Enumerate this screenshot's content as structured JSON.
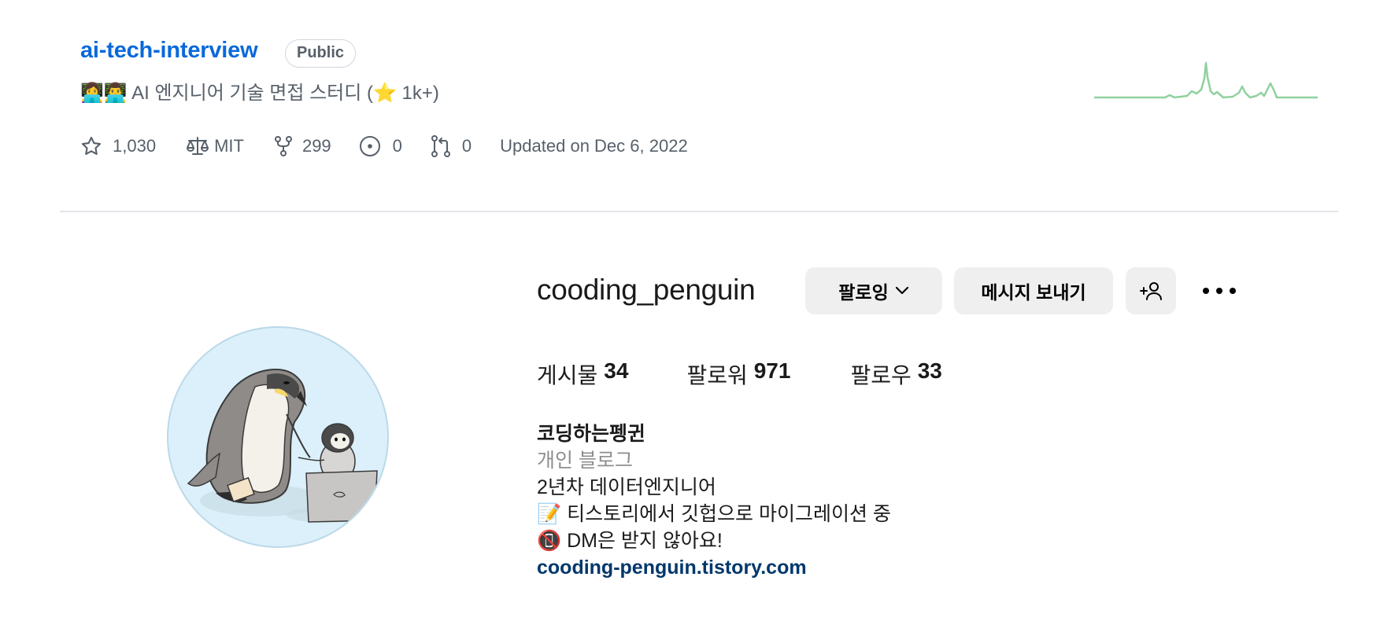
{
  "repo": {
    "name": "ai-tech-interview",
    "visibility": "Public",
    "description": "👩‍💻👨‍💻 AI 엔지니어 기술 면접 스터디 (⭐️ 1k+)",
    "stars": "1,030",
    "license": "MIT",
    "forks": "299",
    "issues": "0",
    "pull_requests": "0",
    "updated": "Updated on Dec 6, 2022",
    "colors": {
      "link": "#0969da",
      "muted": "#57606a",
      "sparkline": "#6fcf87"
    }
  },
  "profile": {
    "username": "cooding_penguin",
    "buttons": {
      "follow": "팔로잉",
      "message": "메시지 보내기",
      "suggest_icon": "person-add-icon",
      "more_icon": "more-horizontal-icon"
    },
    "stats": {
      "posts_label": "게시물",
      "posts": "34",
      "followers_label": "팔로워",
      "followers": "971",
      "following_label": "팔로우",
      "following": "33"
    },
    "bio": {
      "name": "코딩하는펭귄",
      "category": "개인 블로그",
      "lines": [
        "2년차 데이터엔지니어",
        "📝 티스토리에서 깃헙으로 마이그레이션 중",
        "📵 DM은 받지 않아요!"
      ],
      "link": "cooding-penguin.tistory.com"
    },
    "colors": {
      "button_bg": "#efefef",
      "link": "#00376b",
      "muted": "#8e8e8e"
    }
  }
}
